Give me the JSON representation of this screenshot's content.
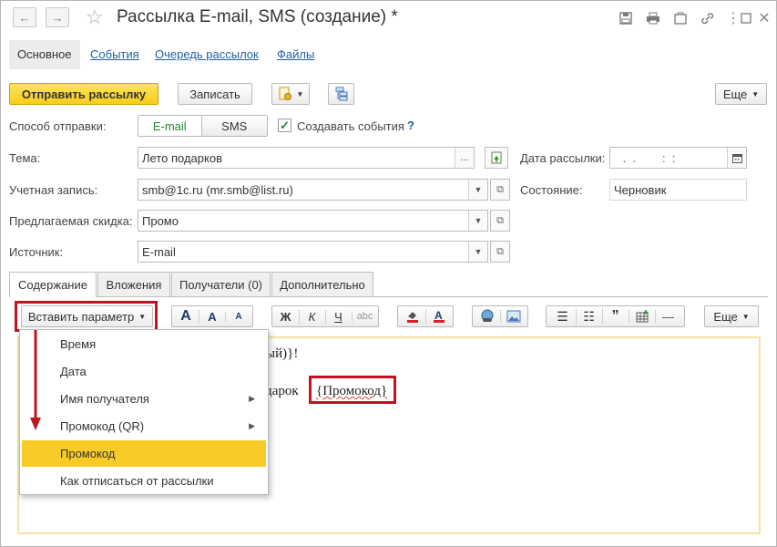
{
  "window": {
    "title": "Рассылка E-mail, SMS (создание) *",
    "nav_back": "🡐",
    "nav_forward": "🡒",
    "title_icons": [
      "save-icon",
      "print-icon",
      "attachment-icon",
      "link-icon",
      "more-icon",
      "maximize-icon",
      "close-icon"
    ]
  },
  "top_tabs": [
    "Основное",
    "События",
    "Очередь рассылок",
    "Файлы"
  ],
  "toolbar": {
    "send_label": "Отправить рассылку",
    "write_label": "Записать",
    "more_label": "Еще"
  },
  "form": {
    "send_method_label": "Способ отправки:",
    "send_method_options": [
      "E-mail",
      "SMS"
    ],
    "send_method_selected": "E-mail",
    "create_events_label": "Создавать события",
    "create_events_checked": true,
    "help": "?",
    "subject_label": "Тема:",
    "subject_value": "Лето подарков",
    "subject_btn": "...",
    "date_label": "Дата рассылки:",
    "date_value": " .  .        :  :",
    "account_label": "Учетная запись:",
    "account_value": "smb@1c.ru (mr.smb@list.ru)",
    "state_label": "Состояние:",
    "state_value": "Черновик",
    "discount_label": "Предлагаемая скидка:",
    "discount_value": "Промо",
    "source_label": "Источник:",
    "source_value": "E-mail"
  },
  "content_tabs": [
    "Содержание",
    "Вложения",
    "Получатели (0)",
    "Дополнительно"
  ],
  "editor_toolbar": {
    "insert_param_label": "Вставить параметр",
    "font_big": "A",
    "font_inc": "A",
    "font_dec": "A",
    "bold": "Ж",
    "italic": "К",
    "underline": "Ч",
    "more_label": "Еще"
  },
  "editor": {
    "line1_fragment": "ный)}!",
    "line2_fragment": "одарок",
    "promo_param": "{Промокод}"
  },
  "dropdown": {
    "items": [
      {
        "label": "Время",
        "submenu": false
      },
      {
        "label": "Дата",
        "submenu": false
      },
      {
        "label": "Имя получателя",
        "submenu": true
      },
      {
        "label": "Промокод (QR)",
        "submenu": true
      },
      {
        "label": "Промокод",
        "submenu": false,
        "selected": true
      },
      {
        "label": "Как отписаться от рассылки",
        "submenu": false
      }
    ]
  },
  "colors": {
    "accent_yellow": "#f9cb26",
    "link_blue": "#1d5fa8",
    "highlight_red": "#c0141e",
    "toggle_green": "#1b8a2e"
  }
}
